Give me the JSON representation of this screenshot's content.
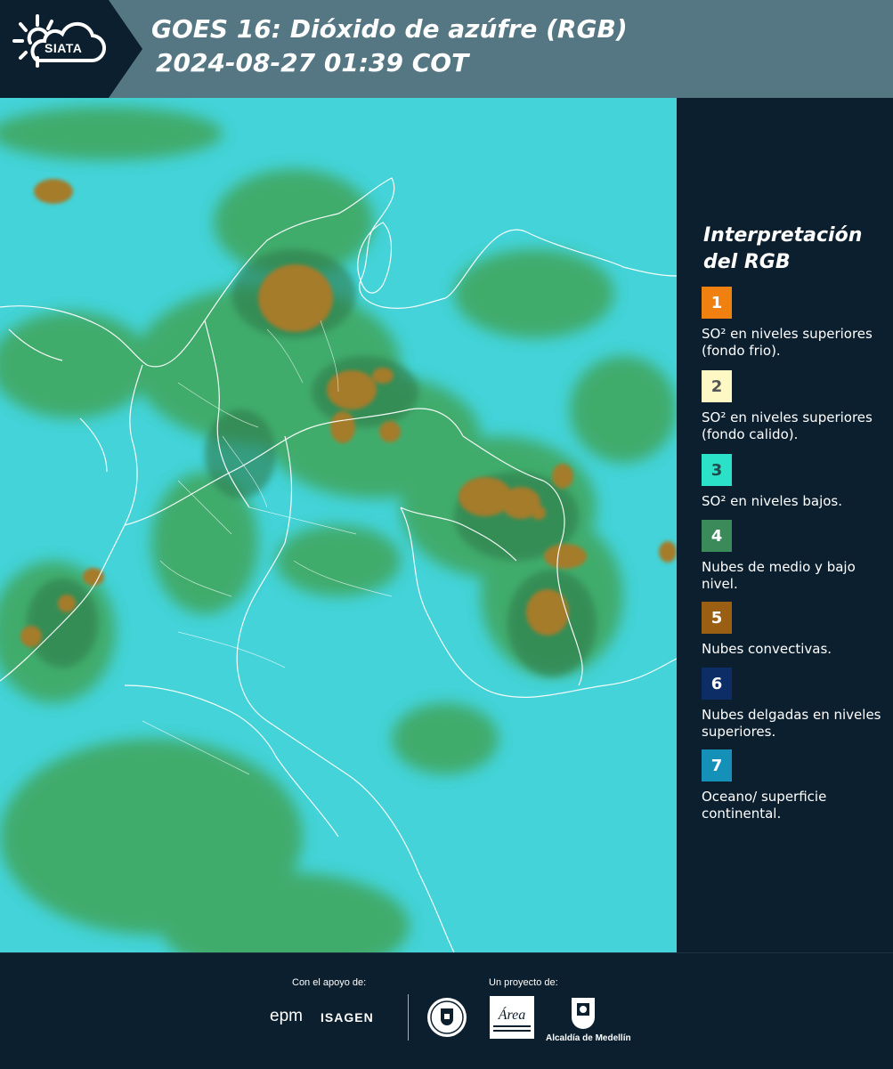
{
  "header": {
    "logo_text": "SIATA",
    "title_line1": "GOES 16: Dióxido de azúfre (RGB)",
    "title_line2": "2024-08-27 01:39 COT"
  },
  "map": {
    "background_color": "#3fd4d6",
    "cloud_color_green": "#3b9e3e",
    "convective_color": "#a07a26",
    "border_color": "#ffffff"
  },
  "legend": {
    "title": "Interpretación del RGB",
    "items": [
      {
        "number": "1",
        "label": "SO² en niveles superiores (fondo frio).",
        "color": "#f08010",
        "text_color": "#ffffff"
      },
      {
        "number": "2",
        "label": "SO² en niveles superiores (fondo calido).",
        "color": "#fdf8c4",
        "text_color": "#555555"
      },
      {
        "number": "3",
        "label": "SO² en niveles bajos.",
        "color": "#2be2c8",
        "text_color": "#1d4d4d"
      },
      {
        "number": "4",
        "label": "Nubes de medio y bajo nivel.",
        "color": "#3a8a5a",
        "text_color": "#ffffff"
      },
      {
        "number": "5",
        "label": "Nubes convectivas.",
        "color": "#9a5f12",
        "text_color": "#ffffff"
      },
      {
        "number": "6",
        "label": "Nubes delgadas en niveles superiores.",
        "color": "#0d2d66",
        "text_color": "#ffffff"
      },
      {
        "number": "7",
        "label": "Oceano/ superficie continental.",
        "color": "#1590b8",
        "text_color": "#ffffff"
      }
    ]
  },
  "footer": {
    "support_label": "Con el apoyo de:",
    "project_label": "Un proyecto de:",
    "epm_logo": "epm",
    "isagen_logo": "ISAGEN",
    "area_logo_text": "Área",
    "area_logo_subtext": "METROPOLITANA Valle de Aburrá",
    "alcaldia_label": "Alcaldía de Medellín"
  }
}
